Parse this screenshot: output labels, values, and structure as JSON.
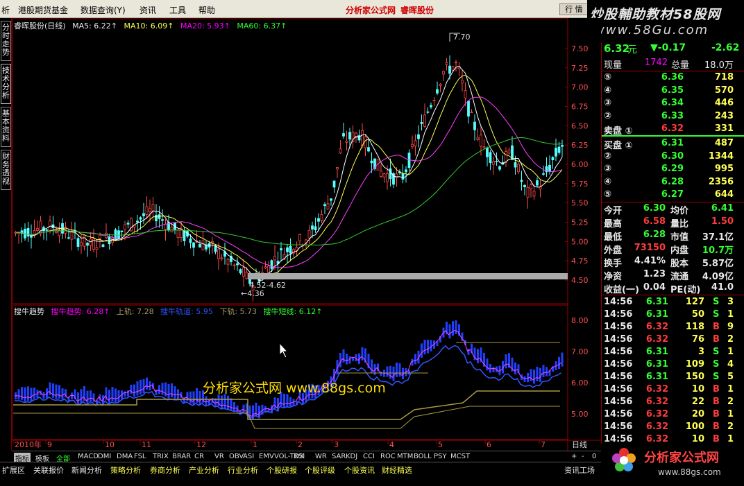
{
  "menu": {
    "items": [
      "析",
      "港股期货基金",
      "数据查询(Y)",
      "资讯",
      "工具",
      "帮助"
    ],
    "brand": "分析家公式网",
    "stock": "睿晖股份",
    "right_btn": "行 情"
  },
  "watermark": {
    "line1": "炒股輔助教材58股网",
    "line2": "www.58Gu.com"
  },
  "sidetabs": [
    "分时走势",
    "技术分析",
    "基本资料",
    "财务透视"
  ],
  "main_header": {
    "title": "睿晖股份(日线)",
    "ma5": "MA5: 6.22↑",
    "ma10": "MA10: 6.09↑",
    "ma20": "MA20: 5.93↑",
    "ma60": "MA60: 6.37↑"
  },
  "price_axis": [
    "7.50",
    "7.25",
    "7.00",
    "6.75",
    "6.50",
    "6.25",
    "6.00",
    "5.75",
    "5.50",
    "5.25",
    "5.00",
    "4.75",
    "4.50"
  ],
  "annotations": {
    "high": "7.70",
    "low_range": "4.52-4.62",
    "low": "←4.36"
  },
  "indicator": {
    "name": "搜牛趋势",
    "l1": "搜牛趋势: 6.28↑",
    "l2": "上轨: 7.28",
    "l3": "搜牛轨道: 5.95",
    "l4": "下轨: 5.73",
    "l5": "搜牛短线: 6.12↑",
    "axis": [
      "8.00",
      "7.00",
      "6.00",
      "5.00"
    ]
  },
  "overlay_text": "分析家公式网  www.88gs.com",
  "time_axis": {
    "labels": [
      "2010年",
      "9",
      "10",
      "11",
      "12",
      "1",
      "2",
      "3",
      "4",
      "5",
      "6",
      "7"
    ],
    "period": "日线"
  },
  "indicator_tabs": [
    "指标",
    "模板",
    "全部",
    "MACD",
    "DMI",
    "DMA",
    "FSL",
    "TRIX",
    "BRAR",
    "CR",
    "VR",
    "OBV",
    "ASI",
    "EMV",
    "VOL-TDX",
    "RSI",
    "WR",
    "SAR",
    "KDJ",
    "CCI",
    "ROC",
    "MTM",
    "BOLL",
    "PSY",
    "MCST"
  ],
  "bottom_tabs": [
    "扩展区",
    "关联报价",
    "新闻分析",
    "策略分析",
    "券商分析",
    "产业分析",
    "行业分析",
    "个股研报",
    "个股评级",
    "个股资讯",
    "财经精选",
    "资讯工场"
  ],
  "quote": {
    "price": "6.32",
    "unit": "元",
    "change": "▼-0.17",
    "pct": "-2.62",
    "xianliang_label": "现量",
    "xianliang": "1742",
    "zongliang_label": "总量",
    "zongliang": "18.0万",
    "sell": [
      {
        "lv": "⑤",
        "p": "6.36",
        "v": "718"
      },
      {
        "lv": "④",
        "p": "6.35",
        "v": "570"
      },
      {
        "lv": "③",
        "p": "6.34",
        "v": "446"
      },
      {
        "lv": "②",
        "p": "6.33",
        "v": "243"
      },
      {
        "lv": "卖盘 ①",
        "p": "6.32",
        "v": "331"
      }
    ],
    "buy": [
      {
        "lv": "买盘 ①",
        "p": "6.31",
        "v": "487"
      },
      {
        "lv": "②",
        "p": "6.30",
        "v": "1344"
      },
      {
        "lv": "③",
        "p": "6.29",
        "v": "995"
      },
      {
        "lv": "④",
        "p": "6.28",
        "v": "2356"
      },
      {
        "lv": "⑤",
        "p": "6.27",
        "v": "644"
      }
    ],
    "stats": [
      {
        "k1": "今开",
        "v1": "6.30",
        "k2": "均价",
        "v2": "6.41"
      },
      {
        "k1": "最高",
        "v1": "6.58",
        "k2": "量比",
        "v2": "1.50"
      },
      {
        "k1": "最低",
        "v1": "6.28",
        "k2": "市值",
        "v2": "37.1亿"
      },
      {
        "k1": "外盘",
        "v1": "73150",
        "k2": "内盘",
        "v2": "10.7万"
      },
      {
        "k1": "换手",
        "v1": "4.41%",
        "k2": "股本",
        "v2": "5.87亿"
      },
      {
        "k1": "净资",
        "v1": "1.23",
        "k2": "流通",
        "v2": "4.09亿"
      },
      {
        "k1": "收益(一)",
        "v1": "0.04",
        "k2": "PE(动)",
        "v2": "41.0"
      }
    ],
    "ticks": [
      {
        "t": "14:56",
        "p": "6.31",
        "v": "127",
        "s": "S",
        "n": "3"
      },
      {
        "t": "14:56",
        "p": "6.31",
        "v": "50",
        "s": "S",
        "n": "1"
      },
      {
        "t": "14:56",
        "p": "6.32",
        "v": "118",
        "s": "B",
        "n": "9"
      },
      {
        "t": "14:56",
        "p": "6.32",
        "v": "76",
        "s": "B",
        "n": "2"
      },
      {
        "t": "14:56",
        "p": "6.31",
        "v": "3",
        "s": "S",
        "n": "1"
      },
      {
        "t": "14:56",
        "p": "6.31",
        "v": "109",
        "s": "S",
        "n": "4"
      },
      {
        "t": "14:56",
        "p": "6.31",
        "v": "150",
        "s": "S",
        "n": "5"
      },
      {
        "t": "14:56",
        "p": "6.32",
        "v": "10",
        "s": "B",
        "n": "1"
      },
      {
        "t": "14:56",
        "p": "6.32",
        "v": "22",
        "s": "B",
        "n": "2"
      },
      {
        "t": "14:56",
        "p": "6.32",
        "v": "20",
        "s": "B",
        "n": "1"
      },
      {
        "t": "14:56",
        "p": "6.32",
        "v": "100",
        "s": "B",
        "n": "2"
      },
      {
        "t": "14:56",
        "p": "6.32",
        "v": "10",
        "s": "B",
        "n": "1"
      }
    ]
  },
  "logo": {
    "text": "分析家公式网",
    "url": "www.88gs.com"
  },
  "colors": {
    "up": "#ff3c3c",
    "down": "#33ff33",
    "ma5": "#ffffff",
    "ma10": "#ffff54",
    "ma20": "#ff40ff",
    "ma60": "#33cc33"
  }
}
